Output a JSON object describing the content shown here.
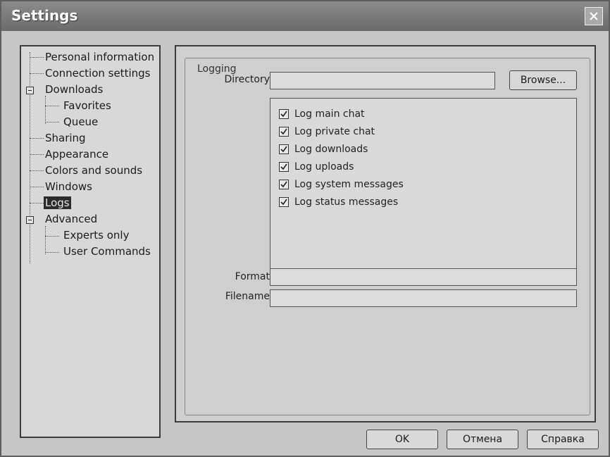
{
  "window": {
    "title": "Settings"
  },
  "tree": {
    "items": [
      {
        "label": "Personal information"
      },
      {
        "label": "Connection settings"
      },
      {
        "label": "Downloads"
      },
      {
        "label": "Favorites"
      },
      {
        "label": "Queue"
      },
      {
        "label": "Sharing"
      },
      {
        "label": "Appearance"
      },
      {
        "label": "Colors and sounds"
      },
      {
        "label": "Windows"
      },
      {
        "label": "Logs"
      },
      {
        "label": "Advanced"
      },
      {
        "label": "Experts only"
      },
      {
        "label": "User Commands"
      }
    ],
    "selected": "Logs"
  },
  "logging": {
    "group_label": "Logging",
    "directory_label": "Directory",
    "directory_value": "",
    "browse_label": "Browse...",
    "options": [
      {
        "label": "Log main chat",
        "checked": true
      },
      {
        "label": "Log private chat",
        "checked": true
      },
      {
        "label": "Log downloads",
        "checked": true
      },
      {
        "label": "Log uploads",
        "checked": true
      },
      {
        "label": "Log system messages",
        "checked": true
      },
      {
        "label": "Log status messages",
        "checked": true
      }
    ],
    "format_label": "Format",
    "format_value": "",
    "filename_label": "Filename",
    "filename_value": ""
  },
  "footer": {
    "ok_label": "OK",
    "cancel_label": "Отмена",
    "help_label": "Справка"
  }
}
